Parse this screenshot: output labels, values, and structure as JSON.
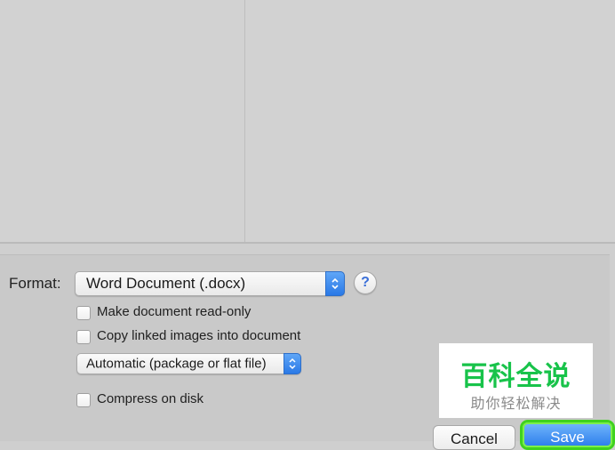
{
  "format": {
    "label": "Format:",
    "selected": "Word Document (.docx)",
    "help": "?"
  },
  "options": {
    "read_only": {
      "label": "Make document read-only",
      "checked": false
    },
    "copy_linked": {
      "label": "Copy linked images into document",
      "checked": false
    },
    "package_selected": "Automatic (package or flat file)",
    "compress": {
      "label": "Compress on disk",
      "checked": false
    }
  },
  "watermark": {
    "title": "百科全说",
    "subtitle": "助你轻松解决"
  },
  "buttons": {
    "cancel": "Cancel",
    "save": "Save"
  },
  "colors": {
    "accent": "#2f80ec",
    "highlight": "#3fd21e",
    "watermark_green": "#18c34a"
  }
}
